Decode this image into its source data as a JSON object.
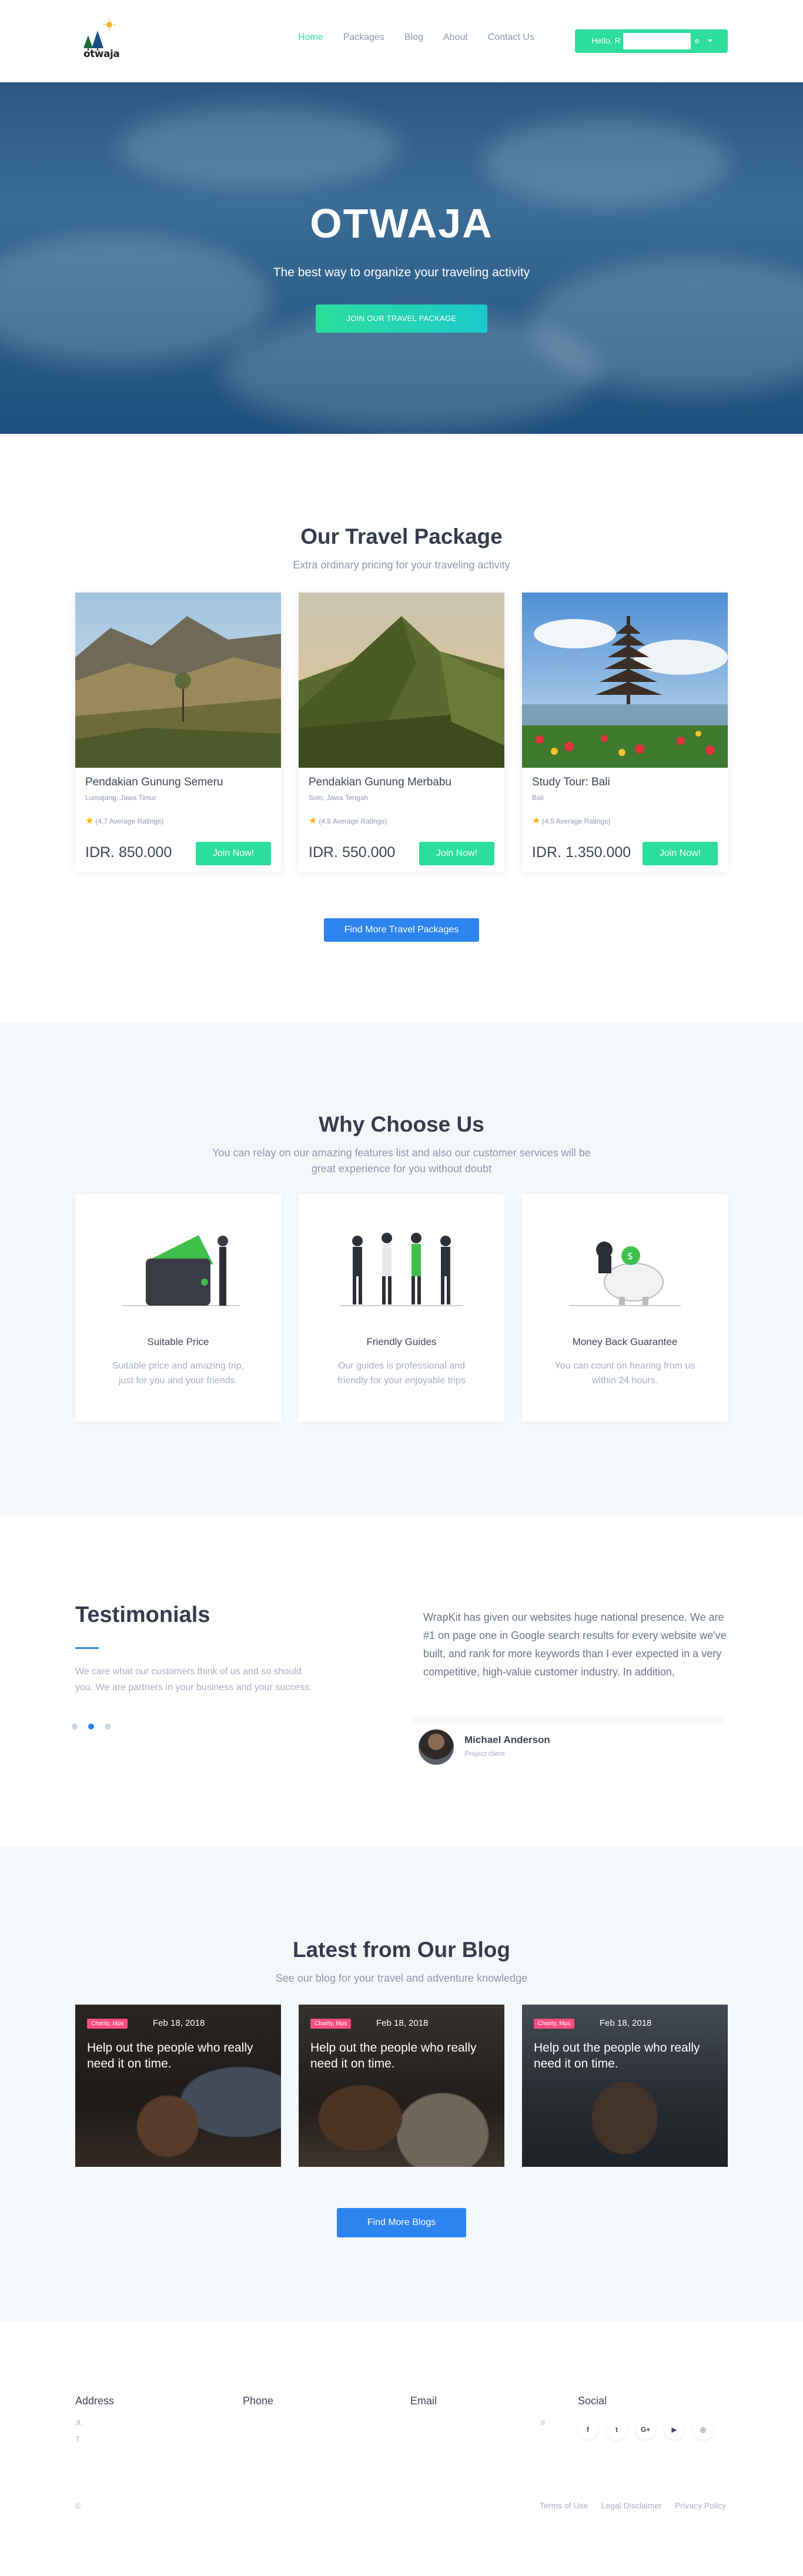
{
  "nav": {
    "logo_text": "otwaja",
    "links": [
      "Home",
      "Packages",
      "Blog",
      "About",
      "Contact Us"
    ],
    "user_label": "Hello, R",
    "user_label_end": "e"
  },
  "hero": {
    "title": "OTWAJA",
    "subtitle": "The best way to organize your traveling activity",
    "cta": "JOIN OUR TRAVEL PACKAGE"
  },
  "packages": {
    "title": "Our Travel Package",
    "subtitle": "Extra ordinary pricing for your traveling activity",
    "items": [
      {
        "title": "Pendakian Gunung Semeru",
        "location": "Lumajang, Jawa Timur",
        "rating": "(4.7 Average Ratings)",
        "price": "IDR. 850.000",
        "button": "Join Now!"
      },
      {
        "title": "Pendakian Gunung Merbabu",
        "location": "Solo, Jawa Tengah",
        "rating": "(4.5 Average Ratings)",
        "price": "IDR. 550.000",
        "button": "Join Now!"
      },
      {
        "title": "Study Tour: Bali",
        "location": "Bali",
        "rating": "(4.5 Average Ratings)",
        "price": "IDR. 1.350.000",
        "button": "Join Now!"
      }
    ],
    "more_button": "Find More Travel Packages"
  },
  "why": {
    "title": "Why Choose Us",
    "subtitle_line1": "You can relay on our amazing features list and also our customer services will be",
    "subtitle_line2": "great experience for you without doubt",
    "items": [
      {
        "title": "Suitable Price",
        "line1": "Suitable price and amazing trip,",
        "line2": "just for you and your friends."
      },
      {
        "title": "Friendly Guides",
        "line1": "Our guides is professional and",
        "line2": "friendly for your enjoyable trips"
      },
      {
        "title": "Money Back Guarantee",
        "line1": "You can count on hearing from us",
        "line2": "within 24 hours."
      }
    ]
  },
  "testimonials": {
    "title": "Testimonials",
    "subtitle_line1": "We care what our customers think of us and so should",
    "subtitle_line2": "you. We are partners in your business and your success.",
    "quote": "WrapKit has given our websites huge national presence. We are #1 on page one in Google search results for every website we've built, and rank for more keywords than I ever expected in a very competitive, high-value customer industry. In addition,",
    "name": "Michael Anderson",
    "role": "Project client"
  },
  "blog": {
    "title": "Latest from Our Blog",
    "subtitle": "See our blog for your travel and adventure knowledge",
    "posts": [
      {
        "tag": "Charity, Mps",
        "date": "Feb 18, 2018",
        "title": "Help out the people who really need it on time."
      },
      {
        "tag": "Charity, Mps",
        "date": "Feb 18, 2018",
        "title": "Help out the people who really need it on time."
      },
      {
        "tag": "Charity, Mps",
        "date": "Feb 18, 2018",
        "title": "Help out the people who really need it on time."
      }
    ],
    "more_button": "Find More Blogs"
  },
  "footer": {
    "headings": [
      "Address",
      "Phone",
      "Email",
      "Social"
    ],
    "address_line1": "Jl.",
    "address_line2": "T",
    "phone_note": "",
    "email_note": "",
    "social_note": "ri",
    "social": [
      "f",
      "t",
      "G+",
      "▶",
      "◎"
    ],
    "copyright": "©",
    "links": [
      "Terms of Use",
      "Legal Disclaimer",
      "Privacy Policy"
    ]
  },
  "colors": {
    "accent_green": "#2cdd9b",
    "accent_blue": "#2c84ee",
    "tag_pink": "#ff4d7e",
    "hero_blue": "#2f618b"
  }
}
